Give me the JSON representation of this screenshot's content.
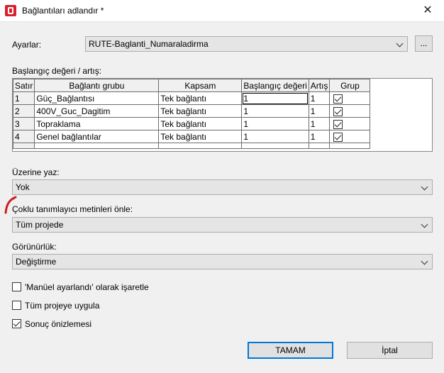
{
  "window": {
    "title": "Bağlantıları adlandır *",
    "close_glyph": "✕"
  },
  "settings": {
    "label": "Ayarlar:",
    "value": "RUTE-Baglanti_Numaraladirma",
    "browse_label": "..."
  },
  "start_values": {
    "label": "Başlangıç değeri / artış:",
    "columns": [
      "Satır",
      "Bağlantı grubu",
      "Kapsam",
      "Başlangıç değeri",
      "Artış",
      "Grup"
    ],
    "rows": [
      {
        "num": "1",
        "group": "Güç_Bağlantısı",
        "scope": "Tek bağlantı",
        "start": "1",
        "step": "1",
        "grouped": true
      },
      {
        "num": "2",
        "group": "400V_Guc_Dagitim",
        "scope": "Tek bağlantı",
        "start": "1",
        "step": "1",
        "grouped": true
      },
      {
        "num": "3",
        "group": "Topraklama",
        "scope": "Tek bağlantı",
        "start": "1",
        "step": "1",
        "grouped": true
      },
      {
        "num": "4",
        "group": "Genel bağlantılar",
        "scope": "Tek bağlantı",
        "start": "1",
        "step": "1",
        "grouped": true
      }
    ]
  },
  "overwrite": {
    "label": "Üzerine yaz:",
    "value": "Yok"
  },
  "prevent_multi": {
    "label": "Çoklu tanımlayıcı metinleri önle:",
    "value": "Tüm projede"
  },
  "visibility": {
    "label": "Görünürlük:",
    "value": "Değiştirme"
  },
  "options": [
    {
      "label": "'Manüel ayarlandı' olarak işaretle",
      "checked": false
    },
    {
      "label": "Tüm projeye uygula",
      "checked": false
    },
    {
      "label": "Sonuç önizlemesi",
      "checked": true
    }
  ],
  "buttons": {
    "ok": "TAMAM",
    "cancel": "İptal"
  },
  "colors": {
    "accent": "#0078d7",
    "annotation": "#cc1f1f",
    "app_icon": "#d9202e"
  }
}
